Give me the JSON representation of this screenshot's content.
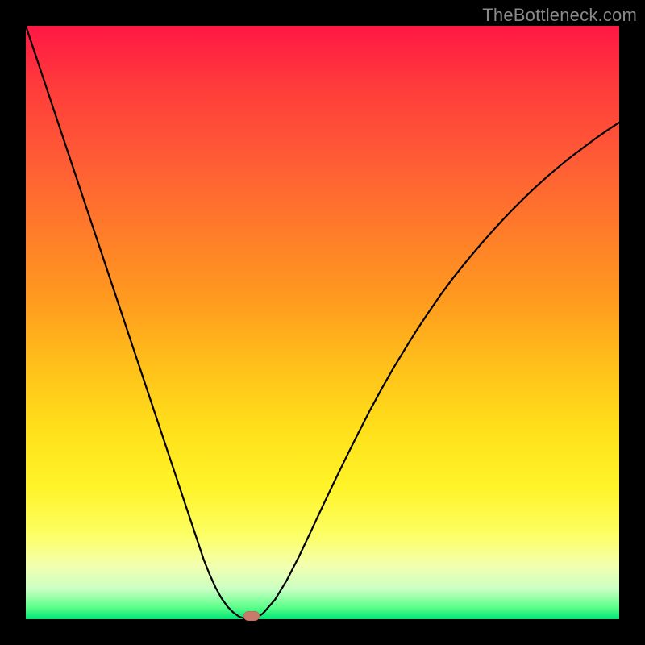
{
  "watermark": "TheBottleneck.com",
  "colors": {
    "frame": "#000000",
    "curve": "#000000",
    "marker": "#c97a6a"
  },
  "chart_data": {
    "type": "line",
    "title": "",
    "xlabel": "",
    "ylabel": "",
    "xlim": [
      0,
      100
    ],
    "ylim": [
      0,
      100
    ],
    "grid": false,
    "legend": false,
    "series": [
      {
        "name": "bottleneck-curve",
        "x": [
          0,
          2,
          4,
          6,
          8,
          10,
          12,
          14,
          16,
          18,
          20,
          22,
          24,
          26,
          28,
          30,
          31,
          32,
          33,
          34,
          35,
          36,
          37,
          38,
          39,
          40,
          42,
          44,
          46,
          48,
          50,
          52,
          54,
          56,
          58,
          60,
          62,
          64,
          66,
          68,
          70,
          72,
          74,
          76,
          78,
          80,
          82,
          84,
          86,
          88,
          90,
          92,
          94,
          96,
          98,
          100
        ],
        "y": [
          100,
          94,
          88,
          82,
          76,
          70,
          64,
          58,
          52,
          46,
          40,
          34,
          28,
          22,
          16,
          10,
          7.5,
          5.3,
          3.5,
          2.1,
          1.1,
          0.4,
          0.1,
          0,
          0.3,
          1,
          3.3,
          6.6,
          10.5,
          14.7,
          19,
          23.2,
          27.3,
          31.3,
          35.2,
          38.9,
          42.4,
          45.7,
          48.9,
          51.9,
          54.8,
          57.5,
          60,
          62.4,
          64.7,
          66.9,
          69,
          71,
          72.9,
          74.7,
          76.4,
          78,
          79.5,
          81,
          82.4,
          83.7
        ]
      }
    ],
    "marker": {
      "x": 38,
      "y": 0
    },
    "annotations": [
      {
        "text": "TheBottleneck.com",
        "position": "top-right"
      }
    ]
  }
}
